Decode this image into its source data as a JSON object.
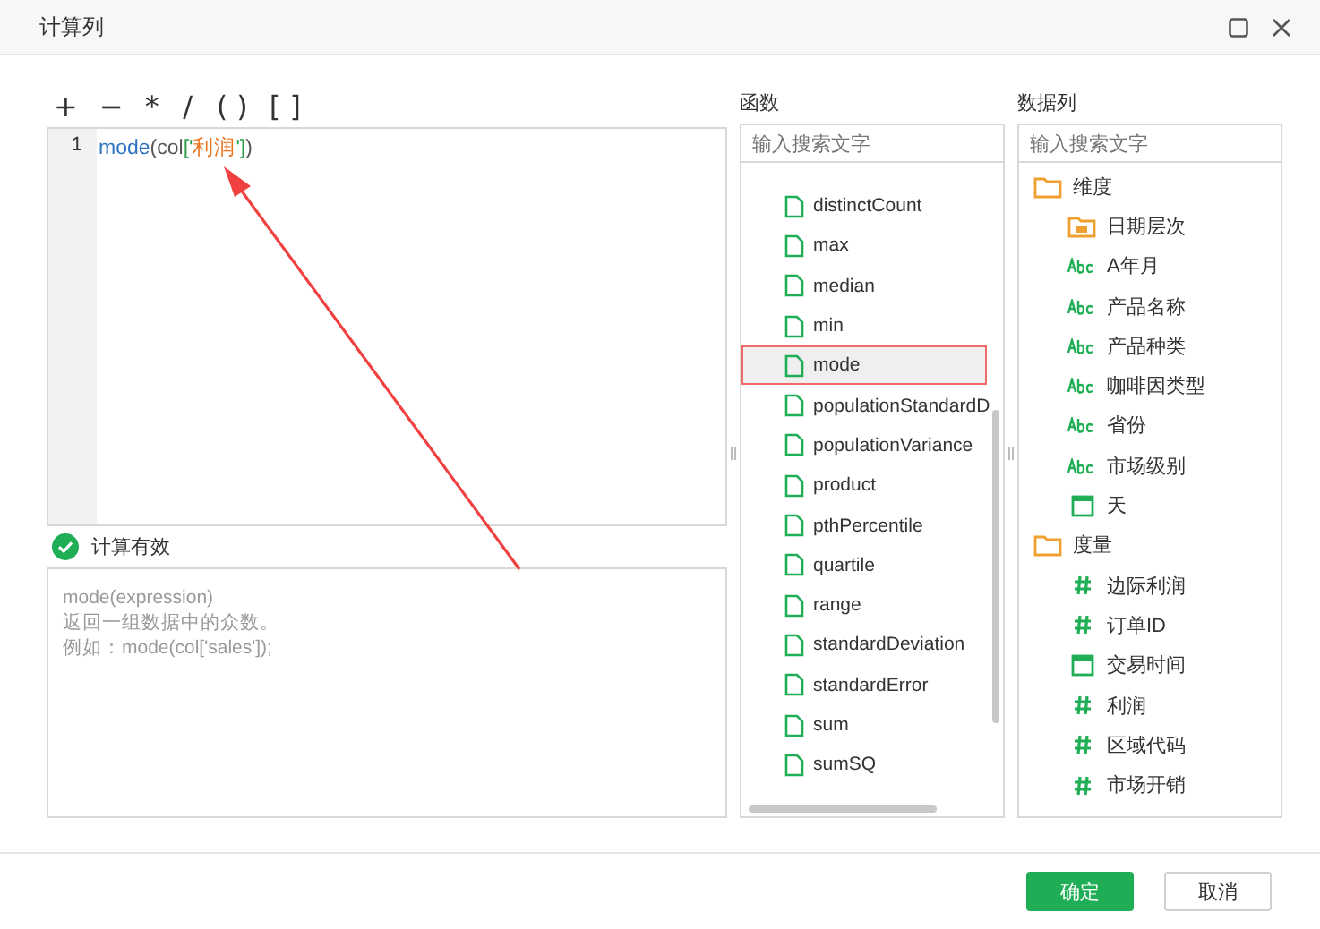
{
  "window": {
    "title": "计算列"
  },
  "operators": [
    "+",
    "−",
    "*",
    "/",
    "( )",
    "[ ]"
  ],
  "editor": {
    "line_number": "1",
    "tokens": [
      {
        "kind": "function",
        "text": "mode"
      },
      {
        "kind": "plain",
        "text": "(col"
      },
      {
        "kind": "bracket",
        "text": "['"
      },
      {
        "kind": "string",
        "text": "利润"
      },
      {
        "kind": "bracket",
        "text": "']"
      },
      {
        "kind": "plain",
        "text": ")"
      }
    ]
  },
  "validation": {
    "valid": true,
    "message": "计算有效"
  },
  "description": [
    "mode(expression)",
    "返回一组数据中的众数。",
    "例如：mode(col['sales']);"
  ],
  "functions": {
    "title": "函数",
    "search": {
      "placeholder": "输入搜索文字"
    },
    "items": [
      {
        "name": "distinctCount",
        "selected": false
      },
      {
        "name": "max",
        "selected": false
      },
      {
        "name": "median",
        "selected": false
      },
      {
        "name": "min",
        "selected": false
      },
      {
        "name": "mode",
        "selected": true
      },
      {
        "name": "populationStandardD",
        "selected": false
      },
      {
        "name": "populationVariance",
        "selected": false
      },
      {
        "name": "product",
        "selected": false
      },
      {
        "name": "pthPercentile",
        "selected": false
      },
      {
        "name": "quartile",
        "selected": false
      },
      {
        "name": "range",
        "selected": false
      },
      {
        "name": "standardDeviation",
        "selected": false
      },
      {
        "name": "standardError",
        "selected": false
      },
      {
        "name": "sum",
        "selected": false
      },
      {
        "name": "sumSQ",
        "selected": false
      }
    ]
  },
  "data_columns": {
    "title": "数据列",
    "search": {
      "placeholder": "输入搜索文字"
    },
    "tree": [
      {
        "kind": "folder",
        "name": "维度",
        "children": [
          {
            "kind": "date-folder",
            "name": "日期层次"
          },
          {
            "kind": "text",
            "name": "A年月"
          },
          {
            "kind": "text",
            "name": "产品名称"
          },
          {
            "kind": "text",
            "name": "产品种类"
          },
          {
            "kind": "text",
            "name": "咖啡因类型"
          },
          {
            "kind": "text",
            "name": "省份"
          },
          {
            "kind": "text",
            "name": "市场级别"
          },
          {
            "kind": "date",
            "name": "天"
          }
        ]
      },
      {
        "kind": "folder",
        "name": "度量",
        "children": [
          {
            "kind": "number",
            "name": "边际利润"
          },
          {
            "kind": "number",
            "name": "订单ID"
          },
          {
            "kind": "date",
            "name": "交易时间"
          },
          {
            "kind": "number",
            "name": "利润"
          },
          {
            "kind": "number",
            "name": "区域代码"
          },
          {
            "kind": "number",
            "name": "市场开销"
          }
        ]
      }
    ]
  },
  "buttons": [
    {
      "kind": "primary",
      "label": "确定"
    },
    {
      "kind": "secondary",
      "label": "取消"
    }
  ]
}
